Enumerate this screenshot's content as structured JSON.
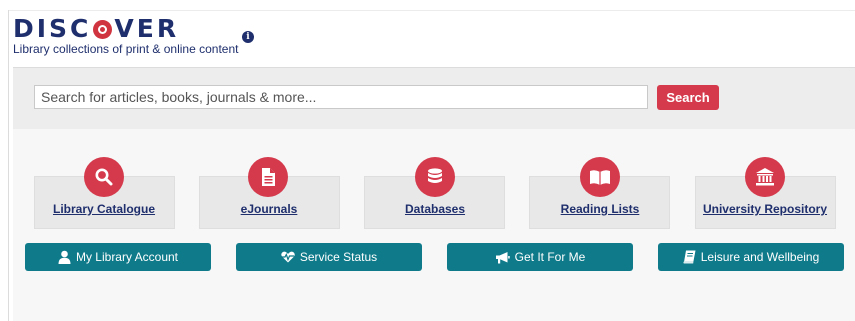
{
  "header": {
    "logo_pre": "DISC",
    "logo_post": "VER",
    "tagline": "Library collections of print & online content",
    "info_glyph": "i",
    "info_icon": "info-circle-icon"
  },
  "search": {
    "placeholder": "Search for articles, books, journals & more...",
    "button_label": "Search"
  },
  "colors": {
    "brand_navy": "#1f2f6d",
    "accent_red": "#d43a4c",
    "action_teal": "#0e7a8a"
  },
  "tiles": [
    {
      "label": "Library Catalogue",
      "icon": "search-icon"
    },
    {
      "label": "eJournals",
      "icon": "document-icon"
    },
    {
      "label": "Databases",
      "icon": "database-icon"
    },
    {
      "label": "Reading Lists",
      "icon": "open-book-icon"
    },
    {
      "label": "University Repository",
      "icon": "institution-icon"
    }
  ],
  "actions": [
    {
      "label": "My Library Account",
      "icon": "user-icon"
    },
    {
      "label": "Service Status",
      "icon": "heartbeat-icon"
    },
    {
      "label": "Get It For Me",
      "icon": "bullhorn-icon"
    },
    {
      "label": "Leisure and Wellbeing",
      "icon": "book-icon"
    }
  ]
}
